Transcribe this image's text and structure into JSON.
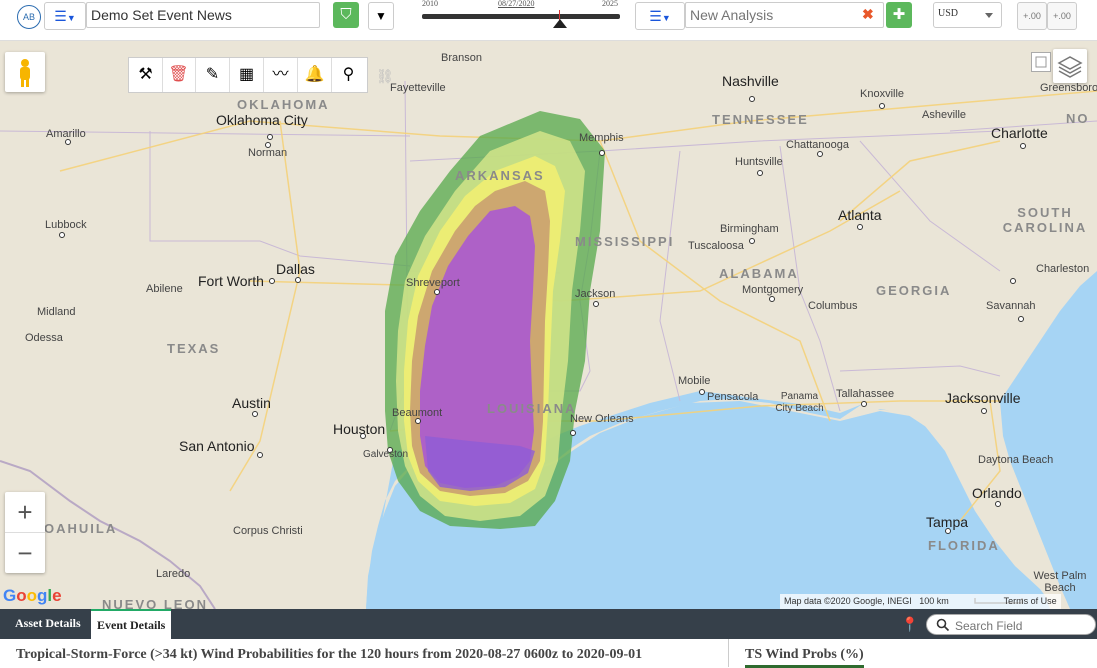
{
  "header": {
    "avatar": "AB",
    "event_name": "Demo Set Event News",
    "timeline": {
      "start": "2010",
      "current": "08/27/2020",
      "end": "2025"
    },
    "analysis_placeholder": "New Analysis",
    "currency": "USD",
    "decimal_increase": "+.00",
    "decimal_decrease": "+.00"
  },
  "map": {
    "labels": {
      "cities": [
        "Branson",
        "Fayetteville",
        "Memphis",
        "Nashville",
        "Knoxville",
        "Greensboro",
        "Asheville",
        "Charlotte",
        "Chattanooga",
        "Huntsville",
        "Birmingham",
        "Atlanta",
        "Tuscaloosa",
        "Jackson",
        "Montgomery",
        "Columbus",
        "Savannah",
        "Charleston",
        "Mobile",
        "Pensacola",
        "Panama City Beach",
        "Tallahassee",
        "Jacksonville",
        "Daytona Beach",
        "Orlando",
        "Tampa",
        "West Palm Beach",
        "New Orleans",
        "Shreveport",
        "Beaumont",
        "Houston",
        "Galveston",
        "Austin",
        "San Antonio",
        "Corpus Christi",
        "Laredo",
        "Dallas",
        "Fort Worth",
        "Abilene",
        "Midland",
        "Odessa",
        "Lubbock",
        "Amarillo",
        "Oklahoma City",
        "Norman"
      ],
      "states": [
        "OKLAHOMA",
        "ARKANSAS",
        "TENNESSEE",
        "MISSISSIPPI",
        "ALABAMA",
        "GEORGIA",
        "SOUTH CAROLINA",
        "NO",
        "LOUISIANA",
        "TEXAS",
        "FLORIDA",
        "OAHUILA",
        "NUEVO LEON"
      ]
    },
    "attribution": "Map data ©2020 Google, INEGI",
    "scale": "100 km",
    "terms": "Terms of Use",
    "google_logo": "Google"
  },
  "tabs": [
    {
      "label": "Asset Details",
      "active": false
    },
    {
      "label": "Event Details",
      "active": true
    }
  ],
  "search": {
    "placeholder": "Search Field"
  },
  "content": {
    "title": "Tropical-Storm-Force (>34 kt) Wind Probabilities for the 120 hours from 2020-08-27 0600z to 2020-09-01",
    "panel_title": "TS Wind Probs (%)"
  },
  "colors": {
    "accent": "#5cb85c",
    "bottom_bar": "#36404a",
    "link_blue": "#1a56db"
  }
}
